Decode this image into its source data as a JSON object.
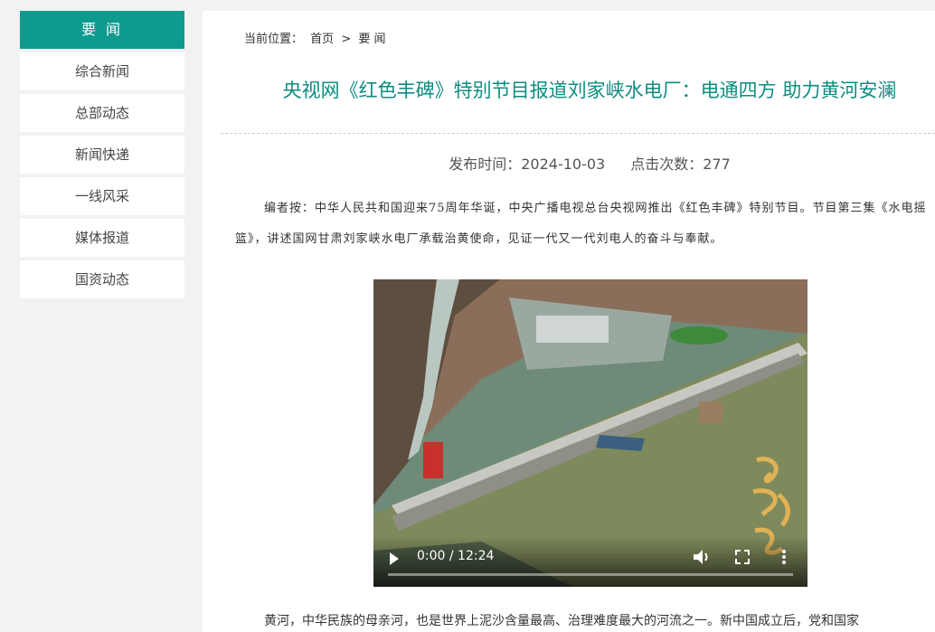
{
  "sidebar": {
    "header": "要 闻",
    "items": [
      {
        "label": "综合新闻"
      },
      {
        "label": "总部动态"
      },
      {
        "label": "新闻快递"
      },
      {
        "label": "一线风采"
      },
      {
        "label": "媒体报道"
      },
      {
        "label": "国资动态"
      }
    ]
  },
  "breadcrumb": {
    "prefix": "当前位置：",
    "home": "首页",
    "separator": ">",
    "current": "要 闻"
  },
  "article": {
    "title": "央视网《红色丰碑》特别节目报道刘家峡水电厂：电通四方 助力黄河安澜",
    "publish_label": "发布时间：2024-10-03",
    "views_label": "点击次数：277",
    "editor_note": "编者按：中华人民共和国迎来75周年华诞，中央广播电视总台央视网推出《红色丰碑》特别节目。节目第三集《水电摇篮》，讲述国网甘肃刘家峡水电厂承载治黄使命，见证一代又一代刘电人的奋斗与奉献。",
    "body_first_line": "黄河，中华民族的母亲河，也是世界上泥沙含量最高、治理难度最大的河流之一。新中国成立后，党和国家"
  },
  "video": {
    "time": "0:00 / 12:24",
    "progress": 0,
    "icons": [
      "play-icon",
      "volume-icon",
      "fullscreen-icon",
      "more-icon"
    ]
  },
  "colors": {
    "accent": "#0f9a8e",
    "title": "#0d8c80"
  }
}
